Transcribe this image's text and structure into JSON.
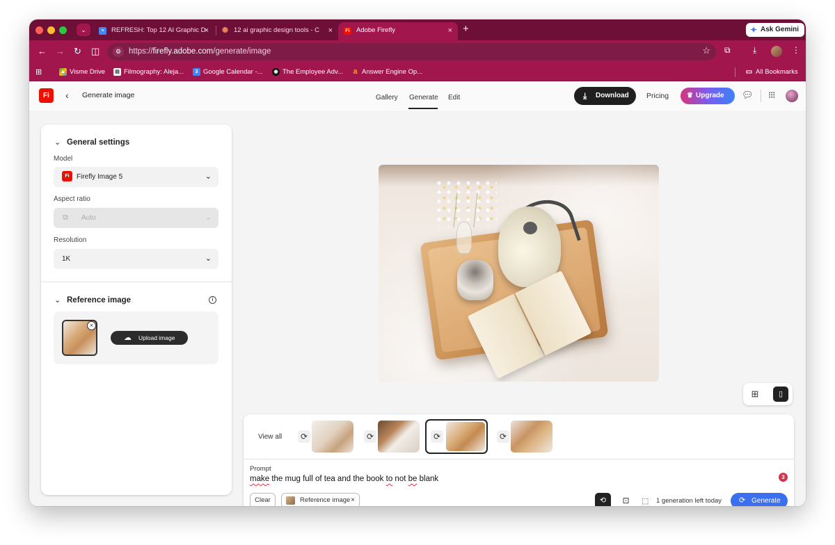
{
  "browser": {
    "tabs": [
      {
        "title": "REFRESH: Top 12 AI Graphic D",
        "icon": "google-docs-icon"
      },
      {
        "title": "12 ai graphic design tools - C",
        "icon": "claude-icon"
      },
      {
        "title": "Adobe Firefly",
        "icon": "firefly-icon"
      }
    ],
    "new_tab": "+",
    "gemini_label": "Ask Gemini",
    "url_prefix": "https://",
    "url_host": "firefly.adobe.com",
    "url_path": "/generate/image",
    "bookmarks": [
      {
        "label": "Visme Drive",
        "icon": "google-drive-icon"
      },
      {
        "label": "Filmography: Aleja...",
        "icon": "filmography-icon"
      },
      {
        "label": "Google Calendar -...",
        "icon": "google-calendar-icon"
      },
      {
        "label": "The Employee Adv...",
        "icon": "employee-adv-icon"
      },
      {
        "label": "Answer Engine Op...",
        "icon": "amazon-icon"
      }
    ],
    "all_bookmarks": "All Bookmarks",
    "theme_color": "#a2164e"
  },
  "app": {
    "logo_text": "Fi",
    "page_name": "Generate image",
    "nav_tabs": [
      "Gallery",
      "Generate",
      "Edit"
    ],
    "active_tab": "Generate",
    "download_label": "Download",
    "pricing_label": "Pricing",
    "upgrade_label": "Upgrade"
  },
  "settings": {
    "general_title": "General settings",
    "model_label": "Model",
    "model_value": "Firefly Image 5",
    "aspect_label": "Aspect ratio",
    "aspect_value": "Auto",
    "resolution_label": "Resolution",
    "resolution_value": "1K",
    "reference_title": "Reference image",
    "upload_label": "Upload image"
  },
  "results": {
    "view_all": "View all",
    "thumbnail_count": 4,
    "selected_index": 2
  },
  "prompt": {
    "label": "Prompt",
    "words": [
      {
        "t": "make",
        "err": true
      },
      {
        "t": " the mug full of tea and the book ",
        "err": false
      },
      {
        "t": "to",
        "err": true
      },
      {
        "t": " not ",
        "err": false
      },
      {
        "t": "be",
        "err": true
      },
      {
        "t": " blank",
        "err": false
      }
    ],
    "badge": "3",
    "clear_label": "Clear",
    "chip_label": "Reference image",
    "chip_close": "×",
    "credits_text": "1 generation left today",
    "generate_label": "Generate"
  },
  "colors": {
    "generate_blue": "#3b6ff0",
    "firefly_red": "#eb1000",
    "error_red": "#d6324a"
  }
}
